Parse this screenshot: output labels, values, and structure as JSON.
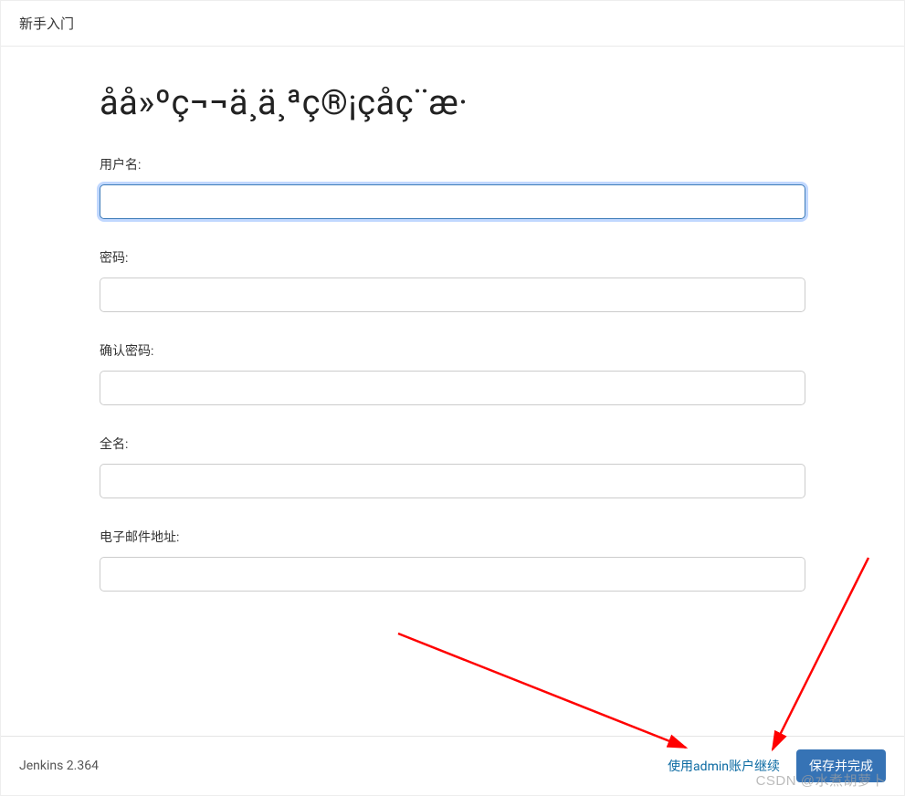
{
  "header": {
    "title": "新手入门"
  },
  "page": {
    "title": "åå»ºç¬¬ä¸ä¸ªç®¡çåç¨æ·"
  },
  "form": {
    "username": {
      "label": "用户名:",
      "value": ""
    },
    "password": {
      "label": "密码:",
      "value": ""
    },
    "confirm_password": {
      "label": "确认密码:",
      "value": ""
    },
    "fullname": {
      "label": "全名:",
      "value": ""
    },
    "email": {
      "label": "电子邮件地址:",
      "value": ""
    }
  },
  "footer": {
    "version": "Jenkins 2.364",
    "skip_link": "使用admin账户继续",
    "save_button": "保存并完成"
  },
  "watermark": "CSDN @水煮胡萝卜"
}
